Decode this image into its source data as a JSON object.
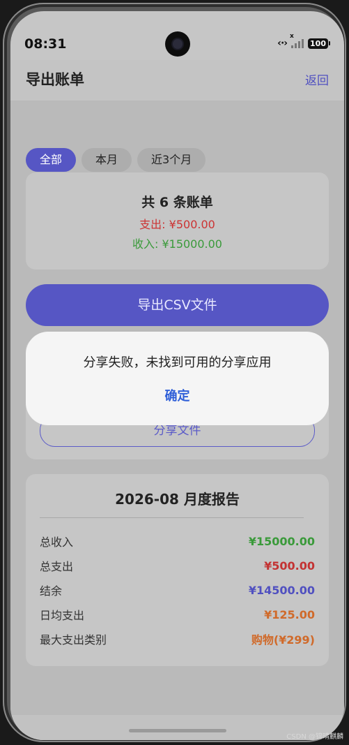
{
  "status_bar": {
    "time": "08:31",
    "network_icon": "‹·›",
    "signal_x": "x",
    "battery_level": "100"
  },
  "header": {
    "title": "导出账单",
    "back_label": "返回"
  },
  "tabs": [
    {
      "label": "全部",
      "active": true
    },
    {
      "label": "本月",
      "active": false
    },
    {
      "label": "近3个月",
      "active": false
    }
  ],
  "summary": {
    "title": "共 6 条账单",
    "expense": "支出: ¥500.00",
    "income": "收入: ¥15000.00"
  },
  "export_button": "导出CSV文件",
  "share_button": "分享文件",
  "report": {
    "title": "2026-08 月度报告",
    "rows": [
      {
        "label": "总收入",
        "value": "¥15000.00",
        "color": "#3a9a3a"
      },
      {
        "label": "总支出",
        "value": "¥500.00",
        "color": "#c33333"
      },
      {
        "label": "结余",
        "value": "¥14500.00",
        "color": "#5050c0"
      },
      {
        "label": "日均支出",
        "value": "¥125.00",
        "color": "#d06a2a"
      },
      {
        "label": "最大支出类别",
        "value": "购物(¥299)",
        "color": "#d06a2a"
      }
    ]
  },
  "dialog": {
    "message": "分享失败，未找到可用的分享应用",
    "confirm_label": "确定"
  },
  "watermark": "CSDN @锦晴麒麟",
  "colors": {
    "accent": "#5656c4",
    "expense": "#cc3333",
    "income": "#3a9a3a",
    "dialog_button": "#2f5fd8"
  }
}
